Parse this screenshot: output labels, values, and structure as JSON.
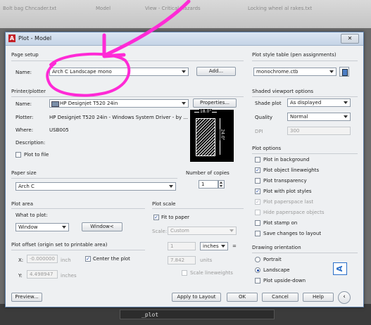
{
  "background": {
    "tabs": [
      "Bolt bag Chncader.txt",
      "Model",
      "View - Critical Hazards",
      "Locking wheel al rakes.txt"
    ],
    "taskbar_item": "_plot"
  },
  "dialog": {
    "title": "Plot - Model",
    "page_setup": {
      "section": "Page setup",
      "name_label": "Name:",
      "name_value": "Arch C Landscape mono",
      "add_button": "Add..."
    },
    "printer": {
      "section": "Printer/plotter",
      "name_label": "Name:",
      "name_value": "HP Designjet T520 24in",
      "properties_button": "Properties...",
      "plotter_label": "Plotter:",
      "plotter_value": "HP Designjet T520 24in - Windows System Driver - by ...",
      "where_label": "Where:",
      "where_value": "USB005",
      "description_label": "Description:",
      "plot_to_file": "Plot to file",
      "preview_width": "18.0\"",
      "preview_height": "24.0\""
    },
    "paper_size": {
      "section": "Paper size",
      "value": "Arch C"
    },
    "copies": {
      "section": "Number of copies",
      "value": "1"
    },
    "plot_area": {
      "section": "Plot area",
      "what_label": "What to plot:",
      "what_value": "Window",
      "window_button": "Window<"
    },
    "plot_scale": {
      "section": "Plot scale",
      "fit_to_paper": "Fit to paper",
      "scale_label": "Scale:",
      "scale_value": "Custom",
      "value1": "1",
      "unit": "inches",
      "equals": "=",
      "value2": "7.842",
      "unit2": "units",
      "scale_lineweights": "Scale lineweights"
    },
    "plot_offset": {
      "section": "Plot offset (origin set to printable area)",
      "x_label": "X:",
      "x_value": "-0.000000",
      "x_unit": "inch",
      "y_label": "Y:",
      "y_value": "4.498947",
      "y_unit": "inches",
      "center": "Center the plot"
    },
    "plot_style": {
      "section": "Plot style table (pen assignments)",
      "value": "monochrome.ctb"
    },
    "shaded": {
      "section": "Shaded viewport options",
      "shade_label": "Shade plot",
      "shade_value": "As displayed",
      "quality_label": "Quality",
      "quality_value": "Normal",
      "dpi_label": "DPI",
      "dpi_value": "300"
    },
    "plot_options": {
      "section": "Plot options",
      "items": [
        "Plot in background",
        "Plot object lineweights",
        "Plot transparency",
        "Plot with plot styles",
        "Plot paperspace last",
        "Hide paperspace objects",
        "Plot stamp on",
        "Save changes to layout"
      ]
    },
    "orientation": {
      "section": "Drawing orientation",
      "portrait": "Portrait",
      "landscape": "Landscape",
      "upside_down": "Plot upside-down"
    },
    "buttons": {
      "preview": "Preview...",
      "apply": "Apply to Layout",
      "ok": "OK",
      "cancel": "Cancel",
      "help": "Help"
    }
  },
  "annotation": {
    "color": "#ff2ad6"
  }
}
